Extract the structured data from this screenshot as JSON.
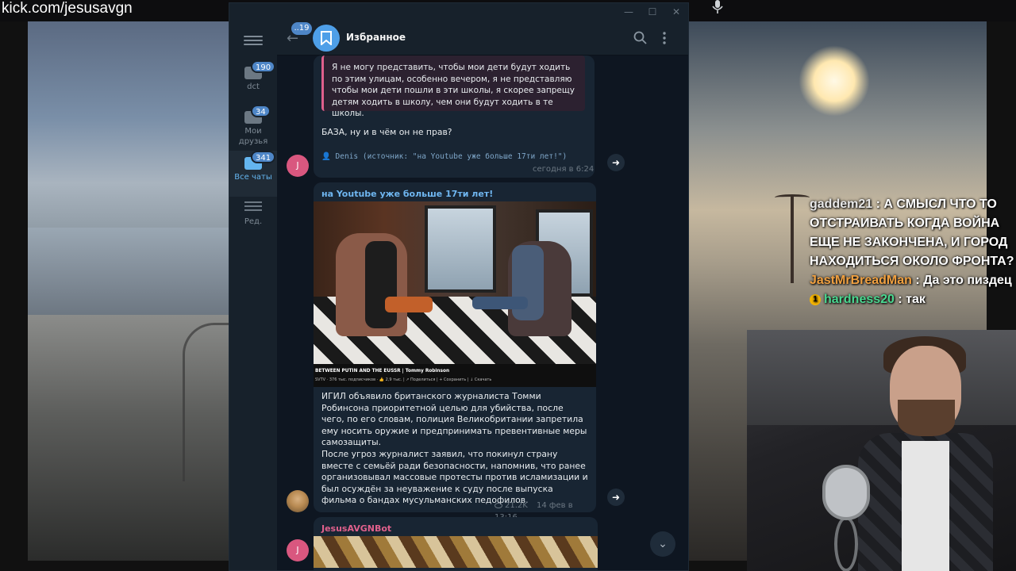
{
  "stream": {
    "site": "kick.com/jesusavgn"
  },
  "chat": [
    {
      "user": "gaddem21",
      "text": " : А СМЫСЛ ЧТО ТО ОТСТРАИВАТЬ КОГДА ВОЙНА ЕЩЕ НЕ ЗАКОНЧЕНА, И ГОРОД НАХОДИТЬСЯ ОКОЛО ФРОНТА?",
      "color": "#e8e8e8"
    },
    {
      "user": "JastMrBreadMan",
      "text": " : Да это пиздец",
      "color": "#f0a040"
    },
    {
      "user": "hardness20",
      "text": " : так",
      "color": "#4ad890",
      "badge": "1"
    }
  ],
  "telegram": {
    "chat_title": "Избранное",
    "back_badge": "..19",
    "folders": [
      {
        "label": "dct",
        "badge": "190",
        "active": false
      },
      {
        "label": "Мои друзья",
        "badge": "34",
        "active": false
      },
      {
        "label": "Все чаты",
        "badge": "341",
        "active": true
      },
      {
        "label": "Ред.",
        "badge": "",
        "active": false
      }
    ],
    "messages": {
      "first": {
        "quote": "Я не могу представить, чтобы мои дети будут ходить по этим улицам, особенно вечером, я не представляю чтобы мои дети пошли в эти школы, я скорее запрещу детям ходить в школу, чем они будут ходить в те школы.",
        "text": "БАЗА, ну и в чём он не прав?",
        "forward": "👤 Denis (источник: \"на Youtube уже больше 17ти лет!\")",
        "time": "сегодня в 6:24",
        "avatar_letter": "J"
      },
      "second": {
        "sender": "на Youtube уже больше 17ти лет!",
        "video_title": "BETWEEN PUTIN AND THE EUSSR | Tommy Robinson",
        "video_meta": "SVTV  ·  376 тыс. подписчиков   ·   👍 2,9 тыс.  |  ↗ Поделиться  |  + Сохранить  |  ↓ Скачать",
        "paragraph1": "ИГИЛ объявило британского журналиста Томми Робинсона приоритетной целью для убийства, после чего, по его словам, полиция Великобритании запретила ему носить оружие и предпринимать превентивные меры самозащиты.",
        "paragraph2": "После угроз журналист заявил, что покинул страну вместе с семьёй ради безопасности, напомнив, что ранее организовывал массовые протесты против исламизации и был осуждён за неуважение к суду после выпуска фильма о бандах мусульманских педофилов.",
        "views": "21.2K",
        "time": "14 фев в 13:16"
      },
      "third": {
        "sender": "JesusAVGNBot",
        "avatar_letter": "J"
      }
    }
  }
}
